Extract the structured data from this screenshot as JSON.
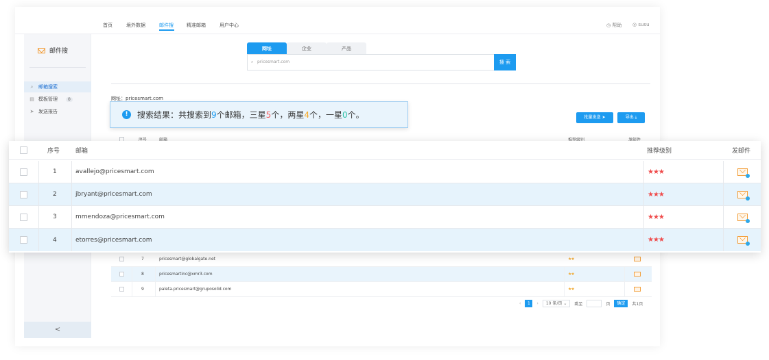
{
  "topnav": {
    "items": [
      "首页",
      "境外数据",
      "邮件搜",
      "精准邮箱",
      "用户中心"
    ],
    "active_index": 2,
    "help": "帮助",
    "username": "susu"
  },
  "sidebar": {
    "brand": "邮件搜",
    "items": [
      {
        "label": "邮箱搜索",
        "icon": "search-icon",
        "active": true
      },
      {
        "label": "模板管理",
        "icon": "document-icon",
        "badge": "0"
      },
      {
        "label": "发送报告",
        "icon": "send-icon"
      }
    ],
    "collapse": "<"
  },
  "search": {
    "tabs": [
      "网址",
      "企业",
      "产品"
    ],
    "active_tab": 0,
    "value": "pricesmart.com",
    "button": "搜 索"
  },
  "site_label": "网址：pricesmart.com",
  "actions": {
    "bulk_send": "批量发送",
    "export": "导出"
  },
  "banner": {
    "prefix": "搜索结果：共搜索到",
    "total": "9",
    "t1": "个邮箱，三星",
    "three_star": "5",
    "t2": "个，两星",
    "two_star": "4",
    "t3": "个，一星",
    "one_star": "0",
    "t4": "个。"
  },
  "table": {
    "columns": {
      "no": "序号",
      "email": "邮箱",
      "level": "推荐级别",
      "send": "发邮件"
    },
    "rows": [
      {
        "no": "1",
        "email": "avallejo@pricesmart.com",
        "stars": "★★★"
      },
      {
        "no": "2",
        "email": "jbryant@pricesmart.com",
        "stars": "★★★"
      },
      {
        "no": "3",
        "email": "mmendoza@pricesmart.com",
        "stars": "★★★"
      },
      {
        "no": "4",
        "email": "etorres@pricesmart.com",
        "stars": "★★★"
      }
    ],
    "bg_rows": [
      {
        "no": "7",
        "email": "pricesmart@globalgate.net",
        "stars": "★★"
      },
      {
        "no": "8",
        "email": "pricesmartinc@xmr3.com",
        "stars": "★★"
      },
      {
        "no": "9",
        "email": "paleta.pricesmart@gruposolid.com",
        "stars": "★★"
      }
    ]
  },
  "pagination": {
    "current": "1",
    "page_size": "10 条/页",
    "goto": "跳至",
    "page_unit": "页",
    "confirm": "确定",
    "total": "共1页"
  },
  "colors": {
    "accent": "#1d9bf0",
    "red_star": "#ef4b4b",
    "orange": "#f5a623",
    "green": "#2fc1a8",
    "row_highlight": "#e6f3fc"
  }
}
